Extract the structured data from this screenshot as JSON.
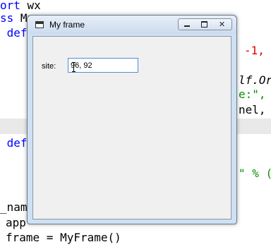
{
  "editor": {
    "lines": [
      {
        "pre": "",
        "kw": "ort",
        "post": " wx"
      },
      {
        "pre": "",
        "kw": "ss",
        "post": " My"
      },
      {
        "pre": " ",
        "kw": "def",
        "post": ""
      },
      {
        "frag": "-1,"
      },
      {
        "frag": "lf.Or"
      },
      {
        "frag": "e:\","
      },
      {
        "frag": "nel,"
      },
      {
        "pre": " ",
        "kw": "def",
        "post": ""
      },
      {
        "frag": "\" % ("
      },
      {
        "frag": "_nam"
      },
      {
        "frag": "app"
      },
      {
        "frag": "frame = MyFrame()"
      }
    ]
  },
  "window": {
    "title": "My frame",
    "icon": "app-window-icon",
    "buttons": {
      "minimize": "minimize-icon",
      "maximize": "maximize-icon",
      "close": "close-icon"
    }
  },
  "form": {
    "site_label": "site:",
    "site_value": "96, 92"
  },
  "colors": {
    "keyword": "#0000ff",
    "number": "#e00000",
    "string": "#0a8f00",
    "window_frame": "#cfe0f3",
    "input_border": "#4d8fd6"
  }
}
